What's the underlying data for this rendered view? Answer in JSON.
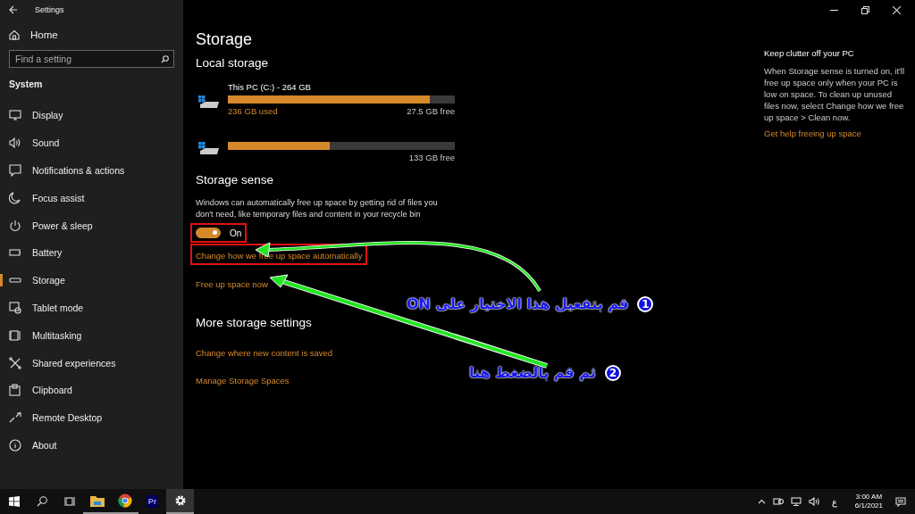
{
  "title_bar": {
    "title": "Settings"
  },
  "sidebar": {
    "home": "Home",
    "search": {
      "placeholder": "Find a setting"
    },
    "section": "System",
    "items": [
      {
        "label": "Display",
        "selected": false
      },
      {
        "label": "Sound",
        "selected": false
      },
      {
        "label": "Notifications & actions",
        "selected": false
      },
      {
        "label": "Focus assist",
        "selected": false
      },
      {
        "label": "Power & sleep",
        "selected": false
      },
      {
        "label": "Battery",
        "selected": false
      },
      {
        "label": "Storage",
        "selected": true
      },
      {
        "label": "Tablet mode",
        "selected": false
      },
      {
        "label": "Multitasking",
        "selected": false
      },
      {
        "label": "Shared experiences",
        "selected": false
      },
      {
        "label": "Clipboard",
        "selected": false
      },
      {
        "label": "Remote Desktop",
        "selected": false
      },
      {
        "label": "About",
        "selected": false
      }
    ]
  },
  "main": {
    "title": "Storage",
    "local_storage": {
      "heading": "Local storage",
      "drives": [
        {
          "name": "This PC (C:) - 264 GB",
          "level": 0.89,
          "used": "236 GB used",
          "free": "27.5 GB free"
        },
        {
          "level": 0.45,
          "free": "133 GB free"
        }
      ]
    },
    "storage_sense": {
      "heading": "Storage sense",
      "description": "Windows can automatically free up space by getting rid of files you don't need, like temporary files and content in your recycle bin",
      "toggle": {
        "on": true,
        "label": "On",
        "highlighted": true
      },
      "links": [
        {
          "text": "Change how we free up space automatically",
          "highlighted": true
        },
        {
          "text": "Free up space now",
          "highlighted": false
        }
      ]
    },
    "more_settings": {
      "heading": "More storage settings",
      "links": [
        "Change where new content is saved",
        "Manage Storage Spaces"
      ]
    }
  },
  "side_panel": {
    "heading": "Keep clutter off your PC",
    "body": "When Storage sense is turned on, it'll free up space only when your PC is low on space. To clean up unused files now, select Change how we free up space > Clean now.",
    "link": "Get help freeing up space"
  },
  "annotations": [
    {
      "number": "1",
      "text": "قم بتفعيل هذا الاختيار على ON"
    },
    {
      "number": "2",
      "text": "ثم قم بالضغط هنا"
    }
  ],
  "taskbar": {
    "apps": [
      {
        "kind": "folder",
        "running": true,
        "active": false
      },
      {
        "kind": "browser",
        "running": true,
        "active": false
      },
      {
        "kind": "premiere",
        "label": "Pr",
        "running": false,
        "active": false
      },
      {
        "kind": "gear",
        "running": true,
        "active": true
      }
    ],
    "input_indicator": "ع",
    "time": "3:00 AM",
    "date": "6/1/2021"
  }
}
